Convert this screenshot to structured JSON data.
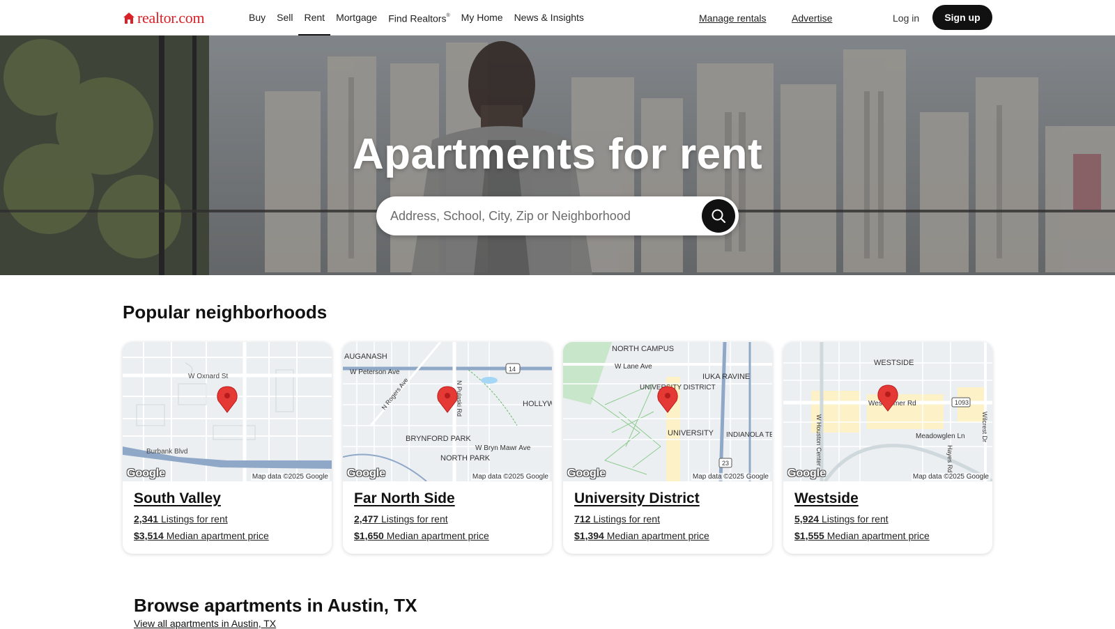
{
  "header": {
    "logo_text": "realtor.com",
    "logo_icon": "house-icon",
    "nav": [
      {
        "label": "Buy"
      },
      {
        "label": "Sell"
      },
      {
        "label": "Rent",
        "active": true
      },
      {
        "label": "Mortgage"
      },
      {
        "label": "Find Realtors"
      },
      {
        "label": "My Home"
      },
      {
        "label": "News & Insights"
      }
    ],
    "find_realtors_mark": "®",
    "manage_rentals": "Manage rentals",
    "advertise": "Advertise",
    "login": "Log in",
    "signup": "Sign up"
  },
  "hero": {
    "title": "Apartments for rent",
    "search_placeholder": "Address, School, City, Zip or Neighborhood",
    "search_icon": "search-icon"
  },
  "neighborhoods": {
    "title": "Popular neighborhoods",
    "map_credit": "Map data ©2025 Google",
    "map_logo": "Google",
    "cards": [
      {
        "name": "South Valley",
        "listings": "2,341",
        "listings_label": "Listings for rent",
        "price": "$3,514",
        "price_label": "Median apartment price",
        "map_labels": [
          "W Oxnard St",
          "Burbank Blvd"
        ]
      },
      {
        "name": "Far North Side",
        "listings": "2,477",
        "listings_label": "Listings for rent",
        "price": "$1,650",
        "price_label": "Median apartment price",
        "map_labels": [
          "AUGANASH",
          "W Peterson Ave",
          "N Rogers Ave",
          "N Pulaski Rd",
          "HOLLYWOOD PARK",
          "BRYNFORD PARK",
          "W Bryn Mawr Ave",
          "NORTH PARK",
          "14"
        ]
      },
      {
        "name": "University District",
        "listings": "712",
        "listings_label": "Listings for rent",
        "price": "$1,394",
        "price_label": "Median apartment price",
        "map_labels": [
          "NORTH CAMPUS",
          "W Lane Ave",
          "IUKA RAVINE",
          "UNIVERSITY DISTRICT",
          "UNIVERSITY",
          "INDIANOLA TERRACE",
          "23"
        ]
      },
      {
        "name": "Westside",
        "listings": "5,924",
        "listings_label": "Listings for rent",
        "price": "$1,555",
        "price_label": "Median apartment price",
        "map_labels": [
          "WESTSIDE",
          "Westheimer Rd",
          "1093",
          "W Houston Center",
          "Meadowglen Ln",
          "Hayes Rd",
          "Wilcrest Dr"
        ]
      }
    ]
  },
  "browse": {
    "title": "Browse apartments in Austin, TX",
    "link": "View all apartments in Austin, TX"
  },
  "colors": {
    "brand_red": "#d92228",
    "pin_red": "#e53935",
    "button_dark": "#111111"
  }
}
